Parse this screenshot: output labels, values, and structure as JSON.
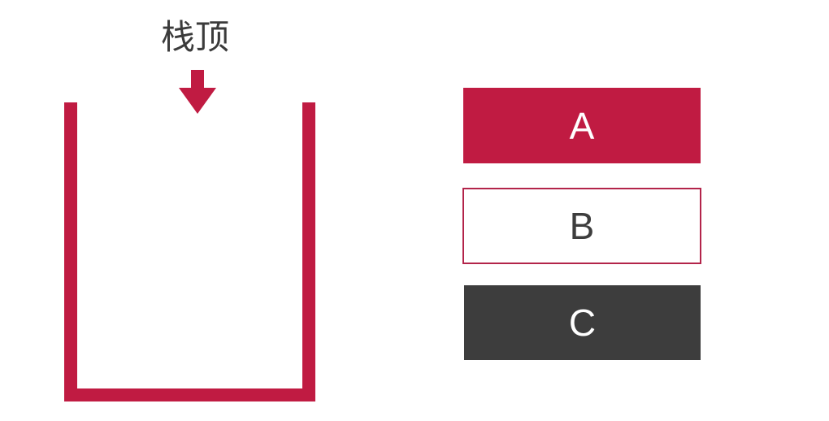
{
  "stack": {
    "top_label": "栈顶",
    "color": "#c01b42"
  },
  "label_color": "#3b3b3b",
  "blocks": [
    {
      "label": "A",
      "fill": "#c01b42",
      "text_color": "#ffffff",
      "border": "#c01b42"
    },
    {
      "label": "B",
      "fill": "#ffffff",
      "text_color": "#3d3d3d",
      "border": "#b3244a"
    },
    {
      "label": "C",
      "fill": "#3d3d3d",
      "text_color": "#ffffff",
      "border": "#3d3d3d"
    }
  ]
}
